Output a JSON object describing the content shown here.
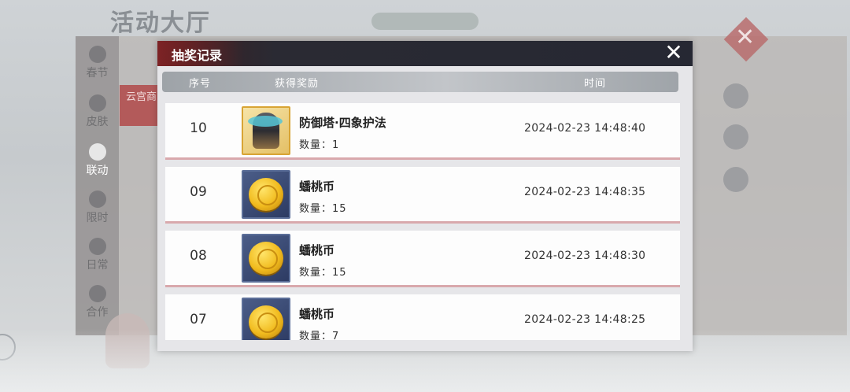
{
  "background": {
    "title": "活动大厅",
    "nav": [
      {
        "label": "春节",
        "active": false
      },
      {
        "label": "皮肤",
        "active": false
      },
      {
        "label": "联动",
        "active": true
      },
      {
        "label": "限时",
        "active": false
      },
      {
        "label": "日常",
        "active": false
      },
      {
        "label": "合作",
        "active": false
      }
    ],
    "banner_text": "云宫商"
  },
  "dialog": {
    "title": "抽奖记录",
    "columns": {
      "number": "序号",
      "reward": "获得奖励",
      "time": "时间"
    },
    "records": [
      {
        "no": "10",
        "name": "防御塔·四象护法",
        "quantity": "数量：1",
        "time": "2024-02-23 14:48:40",
        "icon": "tower-guardian-icon"
      },
      {
        "no": "09",
        "name": "蟠桃币",
        "quantity": "数量：15",
        "time": "2024-02-23 14:48:35",
        "icon": "peach-coin-icon"
      },
      {
        "no": "08",
        "name": "蟠桃币",
        "quantity": "数量：15",
        "time": "2024-02-23 14:48:30",
        "icon": "peach-coin-icon"
      },
      {
        "no": "07",
        "name": "蟠桃币",
        "quantity": "数量：7",
        "time": "2024-02-23 14:48:25",
        "icon": "peach-coin-icon"
      }
    ]
  },
  "colors": {
    "header_dark": "#262833",
    "header_accent": "#7d2325",
    "row_divider": "#d9a9ad",
    "item_frame_gold": "#d8a434"
  }
}
